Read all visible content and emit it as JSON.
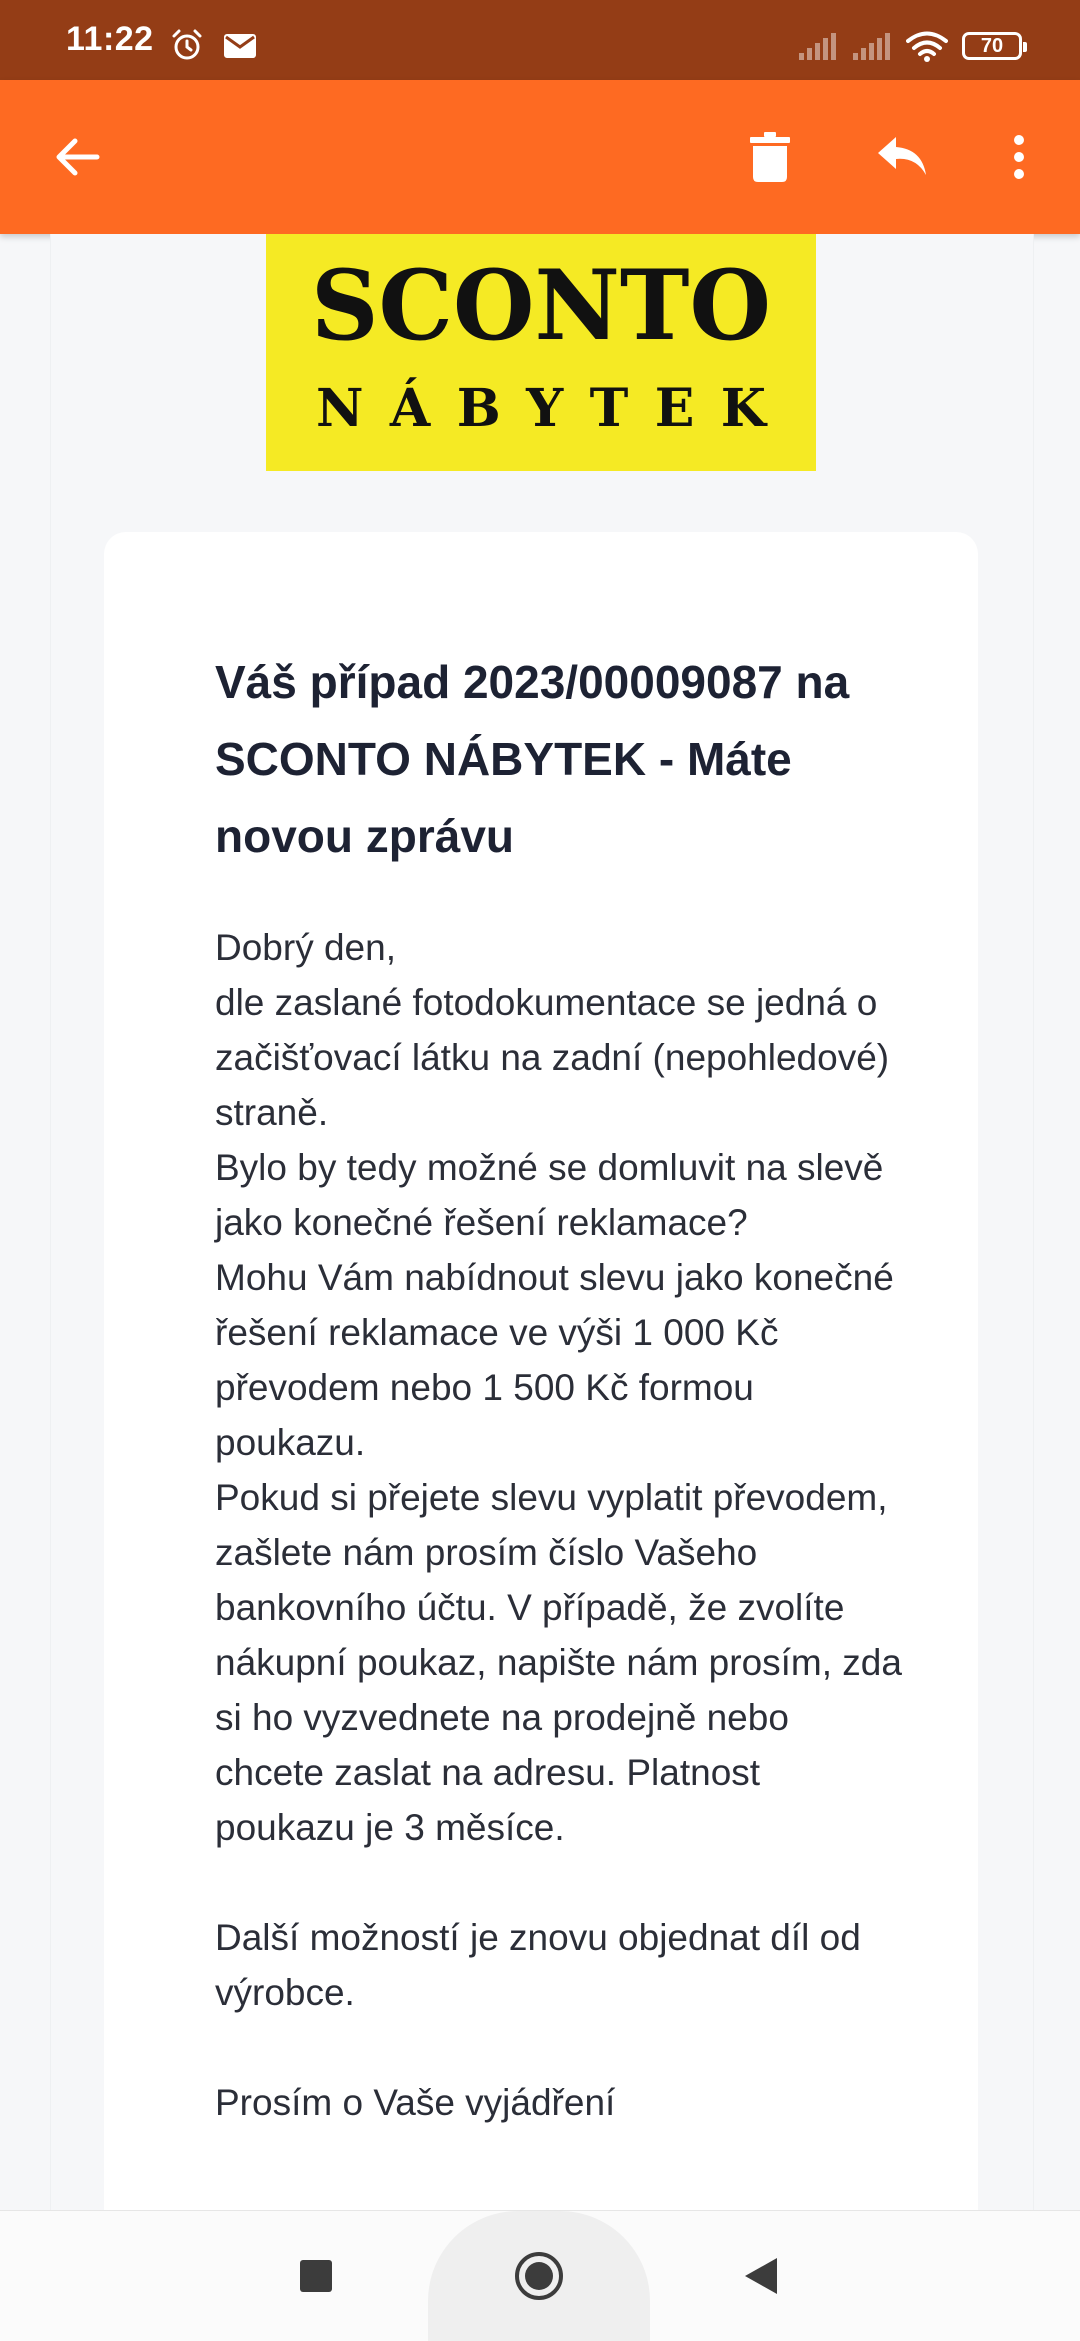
{
  "status_bar": {
    "time": "11:22",
    "battery_level": "70",
    "icons": [
      "alarm-icon",
      "mail-icon",
      "signal-icon",
      "signal-icon",
      "wifi-icon",
      "battery-icon"
    ]
  },
  "app_bar": {
    "actions": [
      "back-arrow-icon",
      "delete-icon",
      "reply-icon",
      "more-vert-icon"
    ],
    "color": "#fe6a22"
  },
  "logo": {
    "line1": "SCONTO",
    "line2": "NÁBYTEK",
    "background": "#f5ea24"
  },
  "email": {
    "title": "Váš případ 2023/00009087 na SCONTO NÁBYTEK - Máte novou zprávu",
    "body": {
      "p1": "Dobrý den,",
      "p2": "dle zaslané fotodokumentace se jedná o začišťovací látku na zadní (nepohledové) straně.",
      "p3": "Bylo by tedy možné se domluvit na slevě jako konečné řešení reklamace?",
      "p4": "Mohu Vám nabídnout slevu jako konečné řešení reklamace ve výši 1 000 Kč převodem nebo 1 500 Kč formou poukazu.",
      "p5": "Pokud si přejete slevu vyplatit převodem, zašlete nám prosím číslo Vašeho bankovního účtu. V případě, že zvolíte nákupní poukaz, napište nám prosím, zda si ho vyzvednete na prodejně nebo chcete zaslat na adresu. Platnost poukazu je 3 měsíce.",
      "p6": "Další možností je znovu objednat díl od výrobce.",
      "p7": "Prosím o Vaše vyjádření"
    }
  },
  "nav_bar": {
    "buttons": [
      "recents-icon",
      "home-icon",
      "back-icon"
    ]
  }
}
